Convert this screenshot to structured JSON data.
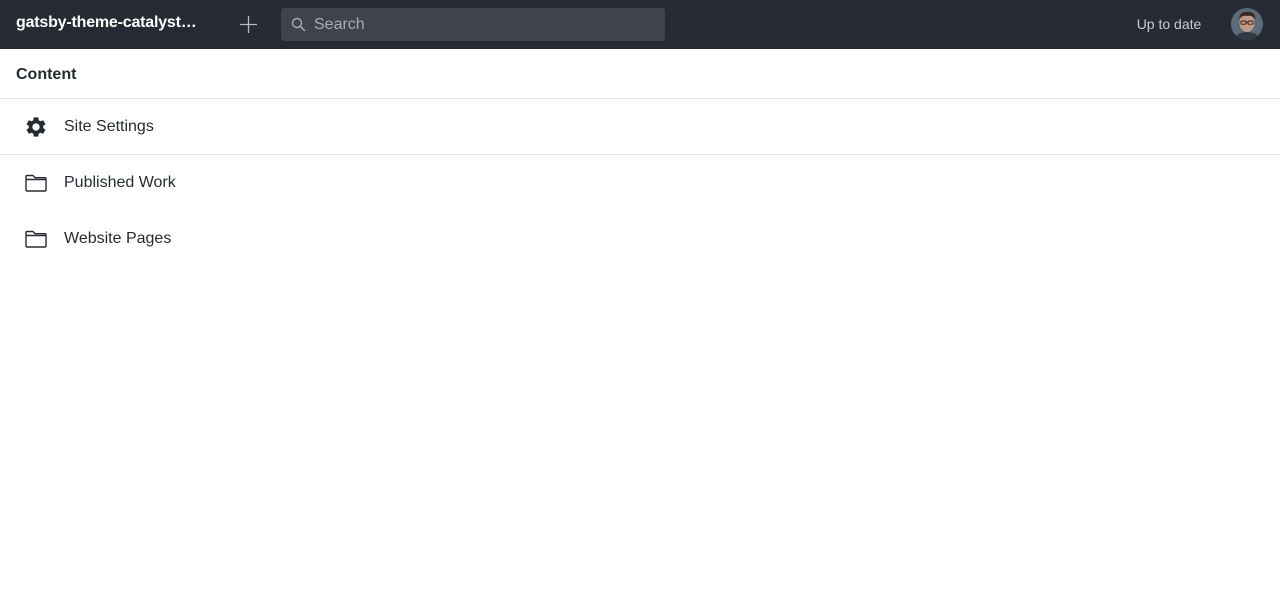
{
  "topbar": {
    "project_title": "gatsby-theme-catalyst…",
    "add_icon": "plus-icon",
    "search": {
      "placeholder": "Search",
      "value": "",
      "icon": "search-icon"
    },
    "status": "Up to date",
    "avatar_icon": "user-avatar"
  },
  "section": {
    "title": "Content"
  },
  "items": [
    {
      "label": "Site Settings",
      "icon": "gear-icon"
    },
    {
      "label": "Published Work",
      "icon": "folder-icon"
    },
    {
      "label": "Website Pages",
      "icon": "folder-icon"
    }
  ],
  "colors": {
    "topbar_bg": "#262b33",
    "search_bg": "#3f444c",
    "text": "#262b33",
    "divider": "#e5e6e8"
  }
}
